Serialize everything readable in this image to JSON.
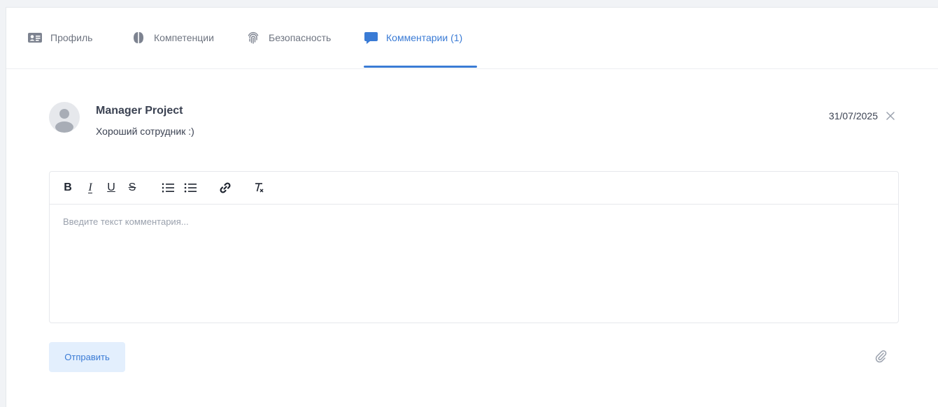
{
  "tabs": [
    {
      "label": "Профиль",
      "icon": "id-card-icon",
      "active": false
    },
    {
      "label": "Компетенции",
      "icon": "brain-icon",
      "active": false
    },
    {
      "label": "Безопасность",
      "icon": "fingerprint-icon",
      "active": false
    },
    {
      "label": "Комментарии (1)",
      "icon": "comment-icon",
      "active": true
    }
  ],
  "comment": {
    "author": "Manager Project",
    "text": "Хороший сотрудник :)",
    "date": "31/07/2025"
  },
  "editor": {
    "toolbar": {
      "bold": "B",
      "italic": "I",
      "underline": "U",
      "strike": "S"
    },
    "placeholder": "Введите текст комментария..."
  },
  "actions": {
    "send_label": "Отправить"
  },
  "colors": {
    "accent": "#3a7bd5",
    "text": "#3b4252",
    "muted": "#6e7480",
    "border": "#e6e8ec",
    "button_bg": "#e3effd"
  }
}
